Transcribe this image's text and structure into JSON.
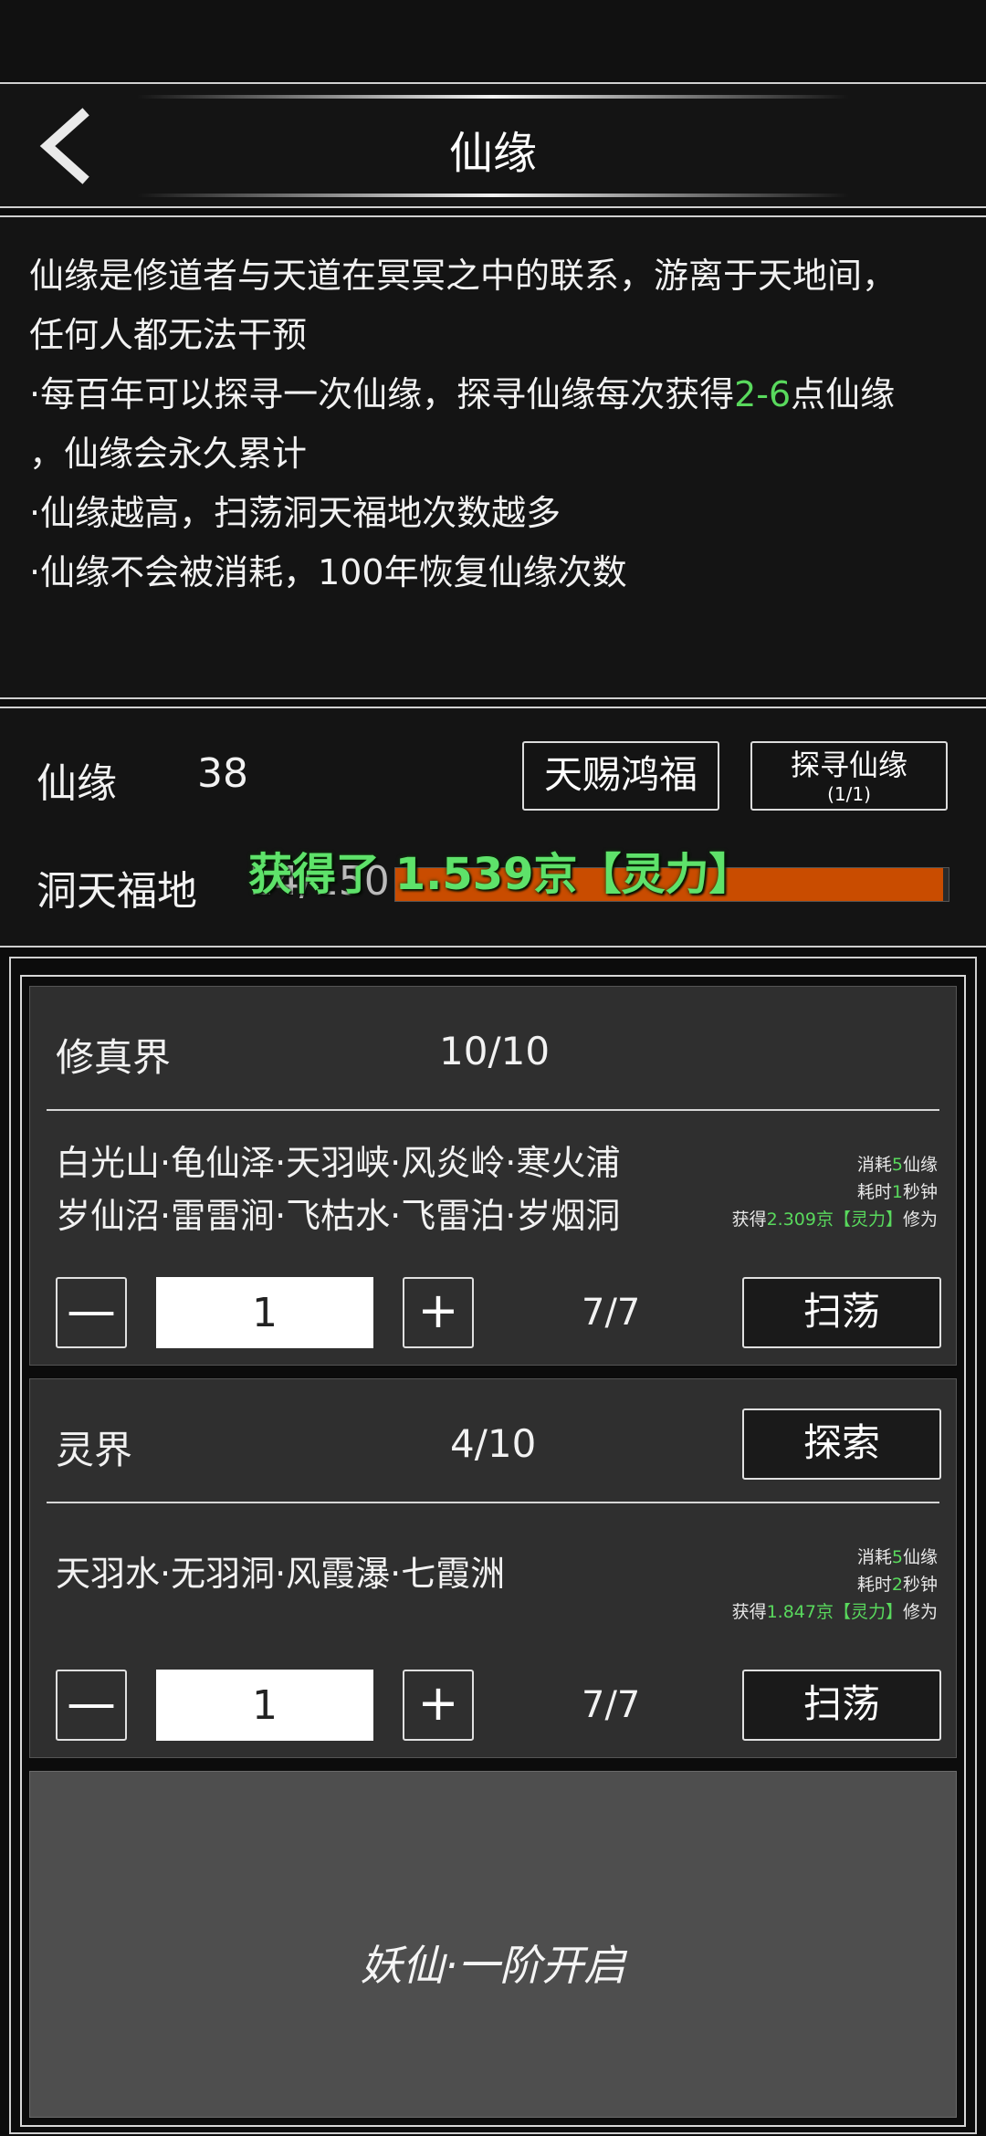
{
  "header": {
    "title": "仙缘"
  },
  "description": {
    "lines": [
      {
        "pre": "仙缘是修道者与天道在冥冥之中的联系，游离于天地间，",
        "hl": "",
        "post": ""
      },
      {
        "pre": "任何人都无法干预",
        "hl": "",
        "post": ""
      },
      {
        "pre": "·每百年可以探寻一次仙缘，探寻仙缘每次获得",
        "hl": "2-6",
        "post": "点仙缘"
      },
      {
        "pre": "，仙缘会永久累计",
        "hl": "",
        "post": ""
      },
      {
        "pre": "·仙缘越高，扫荡洞天福地次数越多",
        "hl": "",
        "post": ""
      },
      {
        "pre": "·仙缘不会被消耗，100年恢复仙缘次数",
        "hl": "",
        "post": ""
      }
    ]
  },
  "stats": {
    "xianyuan_label": "仙缘",
    "xianyuan_value": "38",
    "gift_button": "天赐鸿福",
    "seek_button": "探寻仙缘",
    "seek_count": "(1/1)",
    "dongtian_label": "洞天福地",
    "dongtian_value": "14/150",
    "progress_fraction": 0.99,
    "toast": "获得了 1.539京【灵力】"
  },
  "realms": [
    {
      "title": "修真界",
      "count": "10/10",
      "places": [
        "白光山·龟仙泽·天羽峡·风炎岭·寒火浦",
        "岁仙沼·雷雷涧·飞枯水·飞雷泊·岁烟洞"
      ],
      "meta": {
        "cost_pre": "消耗",
        "cost_num": "5",
        "cost_post": "仙缘",
        "time_pre": "耗时",
        "time_num": "1",
        "time_post": "秒钟",
        "gain_pre": "获得",
        "gain_num": "2.309京【灵力】",
        "gain_post": "修为"
      },
      "quantity": "1",
      "ratio": "7/7",
      "sweep_button": "扫荡"
    },
    {
      "title": "灵界",
      "count": "4/10",
      "explore_button": "探索",
      "places": [
        "天羽水·无羽洞·风霞瀑·七霞洲"
      ],
      "meta": {
        "cost_pre": "消耗",
        "cost_num": "5",
        "cost_post": "仙缘",
        "time_pre": "耗时",
        "time_num": "2",
        "time_post": "秒钟",
        "gain_pre": "获得",
        "gain_num": "1.847京【灵力】",
        "gain_post": "修为"
      },
      "quantity": "1",
      "ratio": "7/7",
      "sweep_button": "扫荡"
    }
  ],
  "locked": {
    "text": "妖仙·一阶开启"
  },
  "icons": {
    "back": "chevron-left-icon",
    "minus": "minus-icon",
    "plus": "plus-icon"
  },
  "colors": {
    "accent_green": "#59d95d",
    "progress_orange": "#c94c00"
  }
}
